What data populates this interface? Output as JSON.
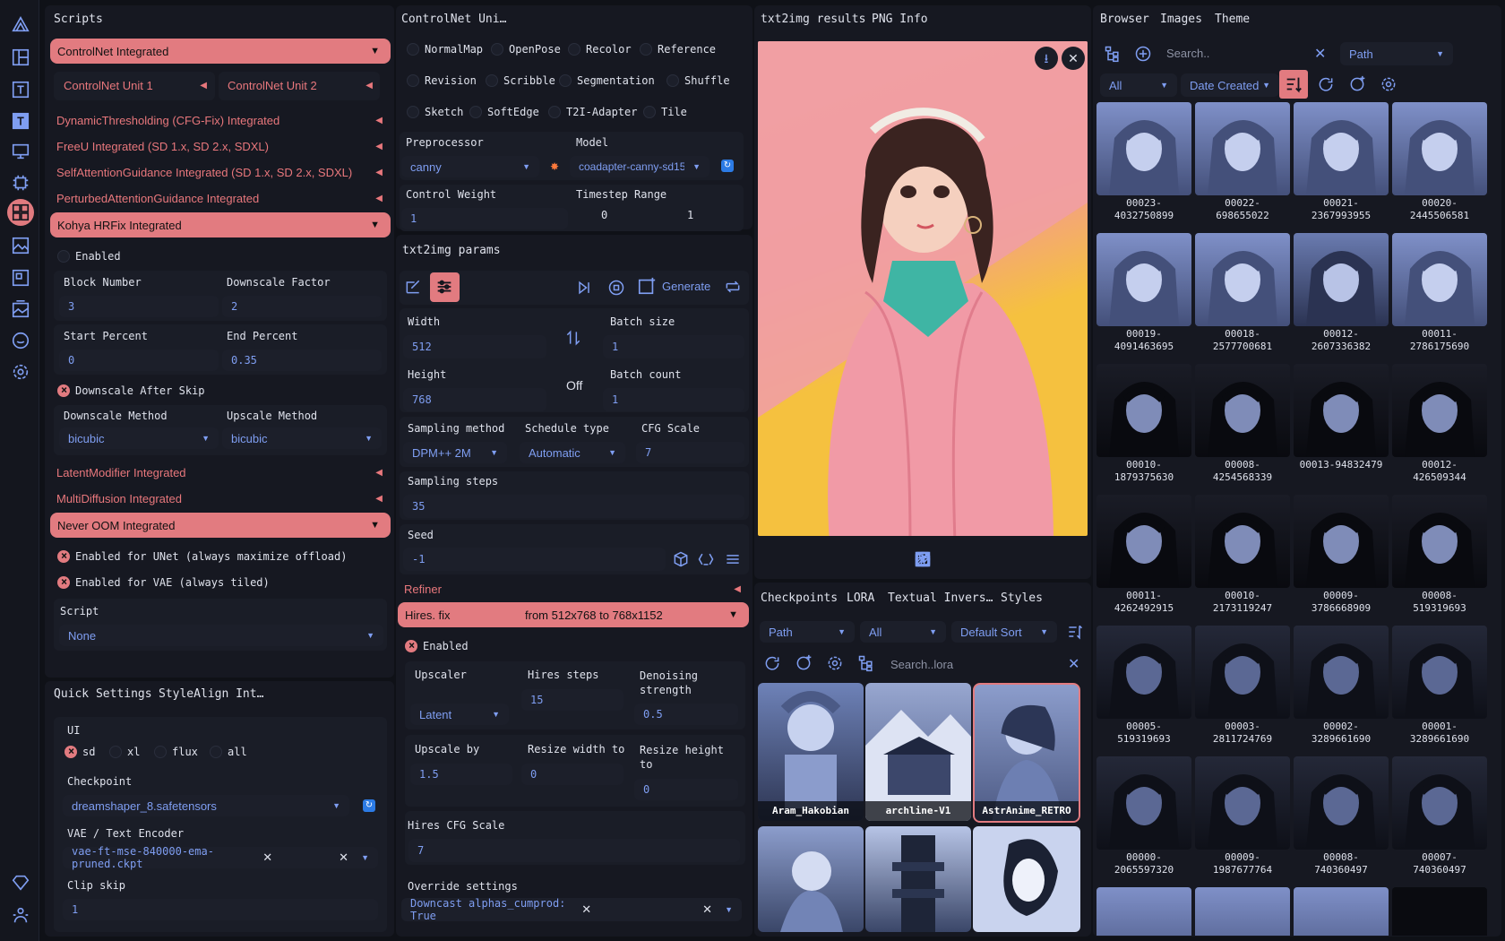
{
  "scripts": {
    "tab": "Scripts",
    "controlnet_integrated": "ControlNet Integrated",
    "unit1": "ControlNet Unit 1",
    "unit2": "ControlNet Unit 2",
    "dynamic_thresholding": "DynamicThresholding (CFG-Fix) Integrated",
    "freeu": "FreeU Integrated (SD 1.x, SD 2.x, SDXL)",
    "self_attention": "SelfAttentionGuidance Integrated (SD 1.x, SD 2.x, SDXL)",
    "perturbed_attention": "PerturbedAttentionGuidance Integrated",
    "kohya": "Kohya HRFix Integrated",
    "kohya_enabled": "Enabled",
    "block_number_label": "Block Number",
    "block_number": "3",
    "downscale_factor_label": "Downscale Factor",
    "downscale_factor": "2",
    "start_percent_label": "Start Percent",
    "start_percent": "0",
    "end_percent_label": "End Percent",
    "end_percent": "0.35",
    "downscale_after_skip": "Downscale After Skip",
    "downscale_method_label": "Downscale Method",
    "downscale_method": "bicubic",
    "upscale_method_label": "Upscale Method",
    "upscale_method": "bicubic",
    "latent_modifier": "LatentModifier Integrated",
    "multidiffusion": "MultiDiffusion Integrated",
    "never_oom": "Never OOM Integrated",
    "unet_offload": "Enabled for UNet (always maximize offload)",
    "vae_tiled": "Enabled for VAE (always tiled)",
    "script_label": "Script",
    "script_value": "None"
  },
  "quick": {
    "tab1": "Quick Settings",
    "tab2": "StyleAlign Int…",
    "ui_label": "UI",
    "ui_options": [
      "sd",
      "xl",
      "flux",
      "all"
    ],
    "checkpoint_label": "Checkpoint",
    "checkpoint": "dreamshaper_8.safetensors",
    "vae_label": "VAE / Text Encoder",
    "vae": "vae-ft-mse-840000-ema-pruned.ckpt",
    "clip_label": "Clip skip",
    "clip": "1"
  },
  "controlnet": {
    "tab": "ControlNet Uni…",
    "types": [
      "NormalMap",
      "OpenPose",
      "Recolor",
      "Reference",
      "Revision",
      "Scribble",
      "Segmentation",
      "Shuffle",
      "Sketch",
      "SoftEdge",
      "T2I-Adapter",
      "Tile"
    ],
    "preprocessor_label": "Preprocessor",
    "preprocessor": "canny",
    "model_label": "Model",
    "model": "coadapter-canny-sd15",
    "weight_label": "Control Weight",
    "weight": "1",
    "timestep_label": "Timestep Range",
    "timestep_start": "0",
    "timestep_end": "1"
  },
  "params": {
    "tab": "txt2img params",
    "generate": "Generate",
    "width_label": "Width",
    "width": "512",
    "height_label": "Height",
    "height": "768",
    "swap_off": "Off",
    "batch_size_label": "Batch size",
    "batch_size": "1",
    "batch_count_label": "Batch count",
    "batch_count": "1",
    "sampling_method_label": "Sampling method",
    "sampling_method": "DPM++ 2M",
    "schedule_type_label": "Schedule type",
    "schedule_type": "Automatic",
    "cfg_label": "CFG Scale",
    "cfg": "7",
    "steps_label": "Sampling steps",
    "steps": "35",
    "seed_label": "Seed",
    "seed": "-1",
    "refiner": "Refiner",
    "hires": "Hires. fix",
    "hires_info": "from 512x768 to 768x1152",
    "hires_enabled": "Enabled",
    "upscaler_label": "Upscaler",
    "upscaler": "Latent",
    "hires_steps_label": "Hires steps",
    "hires_steps": "15",
    "denoise_label": "Denoising strength",
    "denoise": "0.5",
    "upscale_by_label": "Upscale by",
    "upscale_by": "1.5",
    "resize_w_label": "Resize width to",
    "resize_w": "0",
    "resize_h_label": "Resize height to",
    "resize_h": "0",
    "hires_cfg_label": "Hires CFG Scale",
    "hires_cfg": "7",
    "override_label": "Override settings",
    "override": "Downcast alphas_cumprod: True"
  },
  "results": {
    "tab1": "txt2img results",
    "tab2": "PNG Info"
  },
  "lora": {
    "tabs": [
      "Checkpoints",
      "LORA",
      "Textual Invers…",
      "Styles"
    ],
    "path": "Path",
    "filter": "All",
    "sort": "Default Sort",
    "search_placeholder": "Search..lora",
    "cards": [
      "Aram_Hakobian",
      "archline-V1",
      "AstrAnime_RETRO"
    ]
  },
  "browser": {
    "tabs": [
      "Browser",
      "Images",
      "Theme"
    ],
    "search_placeholder": "Search..",
    "path": "Path",
    "filter": "All",
    "sort": "Date Created",
    "items": [
      "00023-\n4032750899",
      "00022-\n698655022",
      "00021-\n2367993955",
      "00020-\n2445506581",
      "00019-\n4091463695",
      "00018-\n2577700681",
      "00012-\n2607336382",
      "00011-\n2786175690",
      "00010-\n1879375630",
      "00008-\n4254568339",
      "00013-94832479",
      "00012-\n426509344",
      "00011-\n4262492915",
      "00010-\n2173119247",
      "00009-\n3786668909",
      "00008-\n519319693",
      "00005-\n519319693",
      "00003-\n2811724769",
      "00002-\n3289661690",
      "00001-\n3289661690",
      "00000-\n2065597320",
      "00009-\n1987677764",
      "00008-\n740360497",
      "00007-\n740360497"
    ]
  },
  "colors": {
    "accent": "#e27b80",
    "link": "#7f9ef2",
    "bg": "#0f1117"
  }
}
